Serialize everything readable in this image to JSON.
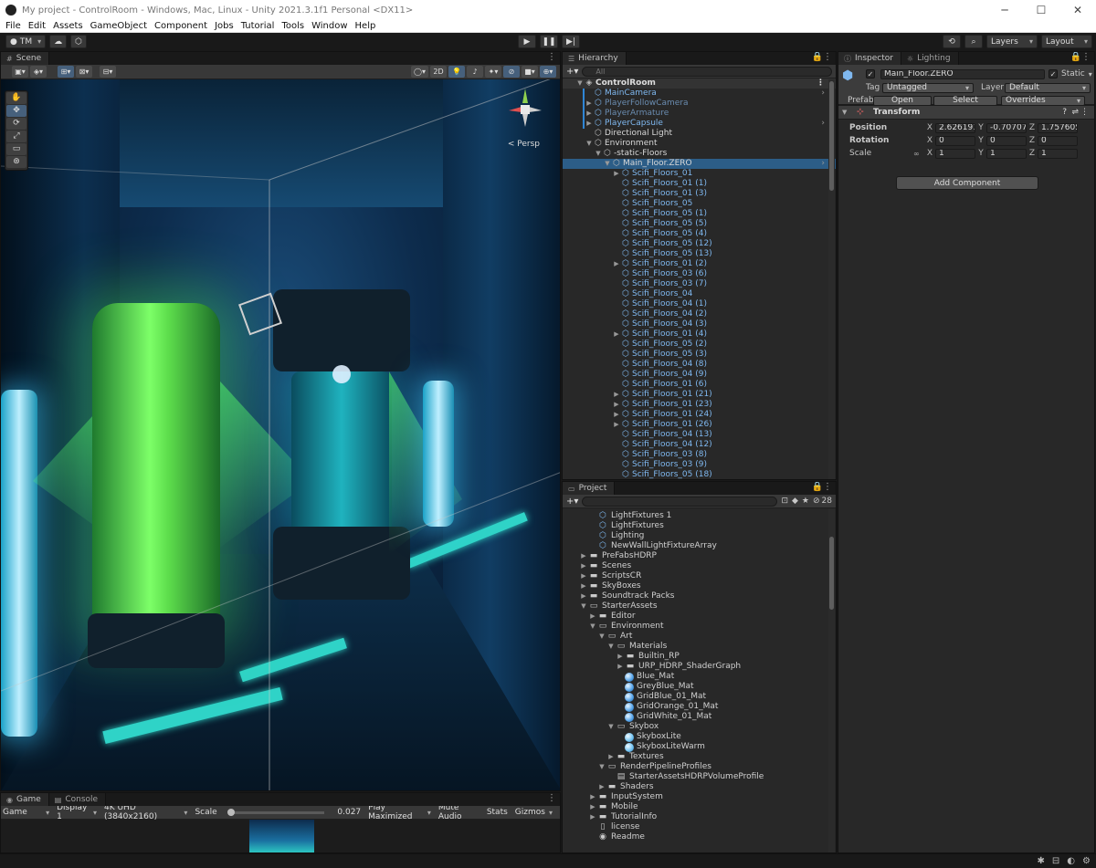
{
  "window": {
    "title": "My project - ControlRoom - Windows, Mac, Linux - Unity 2021.3.1f1 Personal <DX11>"
  },
  "menu": [
    "File",
    "Edit",
    "Assets",
    "GameObject",
    "Component",
    "Jobs",
    "Tutorial",
    "Tools",
    "Window",
    "Help"
  ],
  "toolbar": {
    "account": "TM",
    "layers": "Layers",
    "layout": "Layout"
  },
  "scene": {
    "tab": "Scene",
    "btn_2d": "2D",
    "persp": "< Persp"
  },
  "game": {
    "tabs": [
      "Game",
      "Console"
    ],
    "mode": "Game",
    "display": "Display 1",
    "resolution": "4K UHD (3840x2160)",
    "scale_label": "Scale",
    "scale_value": "0.027",
    "play_mode": "Play Maximized",
    "mute": "Mute Audio",
    "stats": "Stats",
    "gizmos": "Gizmos"
  },
  "hierarchy": {
    "tab": "Hierarchy",
    "search_placeholder": "All",
    "scene_name": "ControlRoom",
    "items": [
      {
        "label": "MainCamera",
        "indent": 1,
        "style": "prefab",
        "arrow": "",
        "blue": true
      },
      {
        "label": "PlayerFollowCamera",
        "indent": 1,
        "style": "dim",
        "arrow": "▶",
        "blue": true
      },
      {
        "label": "PlayerArmature",
        "indent": 1,
        "style": "dim",
        "arrow": "▶",
        "blue": true
      },
      {
        "label": "PlayerCapsule",
        "indent": 1,
        "style": "prefab",
        "arrow": "▶",
        "blue": true
      },
      {
        "label": "Directional Light",
        "indent": 1,
        "style": "white",
        "arrow": "",
        "blue": false
      },
      {
        "label": "Environment",
        "indent": 1,
        "style": "white",
        "arrow": "▼",
        "blue": false
      },
      {
        "label": "-static-Floors",
        "indent": 2,
        "style": "white",
        "arrow": "▼",
        "blue": false
      },
      {
        "label": "Main_Floor.ZERO",
        "indent": 3,
        "style": "white",
        "arrow": "▼",
        "blue": false,
        "selected": true
      },
      {
        "label": "Scifi_Floors_01",
        "indent": 4,
        "style": "prefab",
        "arrow": "▶"
      },
      {
        "label": "Scifi_Floors_01 (1)",
        "indent": 4,
        "style": "prefab",
        "arrow": ""
      },
      {
        "label": "Scifi_Floors_01 (3)",
        "indent": 4,
        "style": "prefab",
        "arrow": ""
      },
      {
        "label": "Scifi_Floors_05",
        "indent": 4,
        "style": "prefab",
        "arrow": ""
      },
      {
        "label": "Scifi_Floors_05 (1)",
        "indent": 4,
        "style": "prefab",
        "arrow": ""
      },
      {
        "label": "Scifi_Floors_05 (5)",
        "indent": 4,
        "style": "prefab",
        "arrow": ""
      },
      {
        "label": "Scifi_Floors_05 (4)",
        "indent": 4,
        "style": "prefab",
        "arrow": ""
      },
      {
        "label": "Scifi_Floors_05 (12)",
        "indent": 4,
        "style": "prefab",
        "arrow": ""
      },
      {
        "label": "Scifi_Floors_05 (13)",
        "indent": 4,
        "style": "prefab",
        "arrow": ""
      },
      {
        "label": "Scifi_Floors_01 (2)",
        "indent": 4,
        "style": "prefab",
        "arrow": "▶"
      },
      {
        "label": "Scifi_Floors_03 (6)",
        "indent": 4,
        "style": "prefab",
        "arrow": ""
      },
      {
        "label": "Scifi_Floors_03 (7)",
        "indent": 4,
        "style": "prefab",
        "arrow": ""
      },
      {
        "label": "Scifi_Floors_04",
        "indent": 4,
        "style": "prefab",
        "arrow": ""
      },
      {
        "label": "Scifi_Floors_04 (1)",
        "indent": 4,
        "style": "prefab",
        "arrow": ""
      },
      {
        "label": "Scifi_Floors_04 (2)",
        "indent": 4,
        "style": "prefab",
        "arrow": ""
      },
      {
        "label": "Scifi_Floors_04 (3)",
        "indent": 4,
        "style": "prefab",
        "arrow": ""
      },
      {
        "label": "Scifi_Floors_01 (4)",
        "indent": 4,
        "style": "prefab",
        "arrow": "▶"
      },
      {
        "label": "Scifi_Floors_05 (2)",
        "indent": 4,
        "style": "prefab",
        "arrow": ""
      },
      {
        "label": "Scifi_Floors_05 (3)",
        "indent": 4,
        "style": "prefab",
        "arrow": ""
      },
      {
        "label": "Scifi_Floors_04 (8)",
        "indent": 4,
        "style": "prefab",
        "arrow": ""
      },
      {
        "label": "Scifi_Floors_04 (9)",
        "indent": 4,
        "style": "prefab",
        "arrow": ""
      },
      {
        "label": "Scifi_Floors_01 (6)",
        "indent": 4,
        "style": "prefab",
        "arrow": ""
      },
      {
        "label": "Scifi_Floors_01 (21)",
        "indent": 4,
        "style": "prefab",
        "arrow": "▶"
      },
      {
        "label": "Scifi_Floors_01 (23)",
        "indent": 4,
        "style": "prefab",
        "arrow": "▶"
      },
      {
        "label": "Scifi_Floors_01 (24)",
        "indent": 4,
        "style": "prefab",
        "arrow": "▶"
      },
      {
        "label": "Scifi_Floors_01 (26)",
        "indent": 4,
        "style": "prefab",
        "arrow": "▶"
      },
      {
        "label": "Scifi_Floors_04 (13)",
        "indent": 4,
        "style": "prefab",
        "arrow": ""
      },
      {
        "label": "Scifi_Floors_04 (12)",
        "indent": 4,
        "style": "prefab",
        "arrow": ""
      },
      {
        "label": "Scifi_Floors_03 (8)",
        "indent": 4,
        "style": "prefab",
        "arrow": ""
      },
      {
        "label": "Scifi_Floors_03 (9)",
        "indent": 4,
        "style": "prefab",
        "arrow": ""
      },
      {
        "label": "Scifi_Floors_05 (18)",
        "indent": 4,
        "style": "prefab",
        "arrow": ""
      }
    ]
  },
  "project": {
    "tab": "Project",
    "hidden_count": "28",
    "items": [
      {
        "label": "LightFixtures 1",
        "indent": 2,
        "icon": "prefab",
        "arrow": ""
      },
      {
        "label": "LightFixtures",
        "indent": 2,
        "icon": "prefab",
        "arrow": ""
      },
      {
        "label": "Lighting",
        "indent": 2,
        "icon": "prefab",
        "arrow": ""
      },
      {
        "label": "NewWallLightFixtureArray",
        "indent": 2,
        "icon": "prefab",
        "arrow": ""
      },
      {
        "label": "PreFabsHDRP",
        "indent": 1,
        "icon": "folder",
        "arrow": "▶"
      },
      {
        "label": "Scenes",
        "indent": 1,
        "icon": "folder",
        "arrow": "▶"
      },
      {
        "label": "ScriptsCR",
        "indent": 1,
        "icon": "folder",
        "arrow": "▶"
      },
      {
        "label": "SkyBoxes",
        "indent": 1,
        "icon": "folder",
        "arrow": "▶"
      },
      {
        "label": "Soundtrack Packs",
        "indent": 1,
        "icon": "folder",
        "arrow": "▶"
      },
      {
        "label": "StarterAssets",
        "indent": 1,
        "icon": "folder-open",
        "arrow": "▼"
      },
      {
        "label": "Editor",
        "indent": 2,
        "icon": "folder",
        "arrow": "▶"
      },
      {
        "label": "Environment",
        "indent": 2,
        "icon": "folder-open",
        "arrow": "▼"
      },
      {
        "label": "Art",
        "indent": 3,
        "icon": "folder-open",
        "arrow": "▼"
      },
      {
        "label": "Materials",
        "indent": 4,
        "icon": "folder-open",
        "arrow": "▼"
      },
      {
        "label": "Builtin_RP",
        "indent": 5,
        "icon": "folder",
        "arrow": "▶"
      },
      {
        "label": "URP_HDRP_ShaderGraph",
        "indent": 5,
        "icon": "folder",
        "arrow": "▶"
      },
      {
        "label": "Blue_Mat",
        "indent": 5,
        "icon": "material",
        "arrow": ""
      },
      {
        "label": "GreyBlue_Mat",
        "indent": 5,
        "icon": "material",
        "arrow": ""
      },
      {
        "label": "GridBlue_01_Mat",
        "indent": 5,
        "icon": "material",
        "arrow": ""
      },
      {
        "label": "GridOrange_01_Mat",
        "indent": 5,
        "icon": "material",
        "arrow": ""
      },
      {
        "label": "GridWhite_01_Mat",
        "indent": 5,
        "icon": "material",
        "arrow": ""
      },
      {
        "label": "Skybox",
        "indent": 4,
        "icon": "folder-open",
        "arrow": "▼"
      },
      {
        "label": "SkyboxLite",
        "indent": 5,
        "icon": "skybox",
        "arrow": ""
      },
      {
        "label": "SkyboxLiteWarm",
        "indent": 5,
        "icon": "skybox",
        "arrow": ""
      },
      {
        "label": "Textures",
        "indent": 4,
        "icon": "folder",
        "arrow": "▶"
      },
      {
        "label": "RenderPipelineProfiles",
        "indent": 3,
        "icon": "folder-open",
        "arrow": "▼"
      },
      {
        "label": "StarterAssetsHDRPVolumeProfile",
        "indent": 4,
        "icon": "profile",
        "arrow": ""
      },
      {
        "label": "Shaders",
        "indent": 3,
        "icon": "folder",
        "arrow": "▶"
      },
      {
        "label": "InputSystem",
        "indent": 2,
        "icon": "folder",
        "arrow": "▶"
      },
      {
        "label": "Mobile",
        "indent": 2,
        "icon": "folder",
        "arrow": "▶"
      },
      {
        "label": "TutorialInfo",
        "indent": 2,
        "icon": "folder",
        "arrow": "▶"
      },
      {
        "label": "license",
        "indent": 2,
        "icon": "doc",
        "arrow": ""
      },
      {
        "label": "Readme",
        "indent": 2,
        "icon": "readme",
        "arrow": ""
      }
    ]
  },
  "inspector": {
    "tabs": [
      "Inspector",
      "Lighting"
    ],
    "object_name": "Main_Floor.ZERO",
    "static_label": "Static",
    "tag_label": "Tag",
    "tag_value": "Untagged",
    "layer_label": "Layer",
    "layer_value": "Default",
    "prefab_label": "Prefab",
    "open_btn": "Open",
    "select_btn": "Select",
    "overrides_btn": "Overrides",
    "transform_title": "Transform",
    "position_label": "Position",
    "rotation_label": "Rotation",
    "scale_label": "Scale",
    "position": {
      "x": "2.626191",
      "y": "-0.70707",
      "z": "1.757605"
    },
    "rotation": {
      "x": "0",
      "y": "0",
      "z": "0"
    },
    "scale": {
      "x": "1",
      "y": "1",
      "z": "1"
    },
    "add_component": "Add Component"
  },
  "colors": {
    "selection": "#2c5d87",
    "prefab_text": "#7fb8f0",
    "panel_bg": "#282828"
  }
}
